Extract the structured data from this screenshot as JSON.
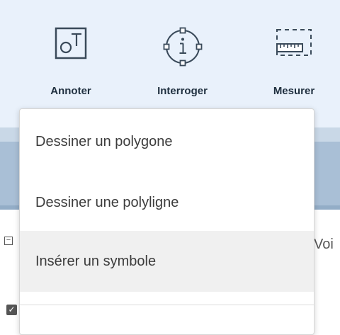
{
  "toolbar": {
    "tools": [
      {
        "label": "Annoter",
        "icon": "annotate-icon"
      },
      {
        "label": "Interroger",
        "icon": "info-icon"
      },
      {
        "label": "Mesurer",
        "icon": "ruler-icon"
      }
    ]
  },
  "background": {
    "partial_text": "Voi"
  },
  "dropdown": {
    "items": [
      {
        "label": "Dessiner un polygone"
      },
      {
        "label": "Dessiner une polyligne"
      },
      {
        "label": "Insérer un symbole",
        "highlighted": true
      }
    ]
  },
  "colors": {
    "toolbar_bg": "#e9f1fb",
    "label_text": "#1f2f3f",
    "menu_text": "#3c3c3c",
    "menu_highlight": "#f0f0f0"
  }
}
